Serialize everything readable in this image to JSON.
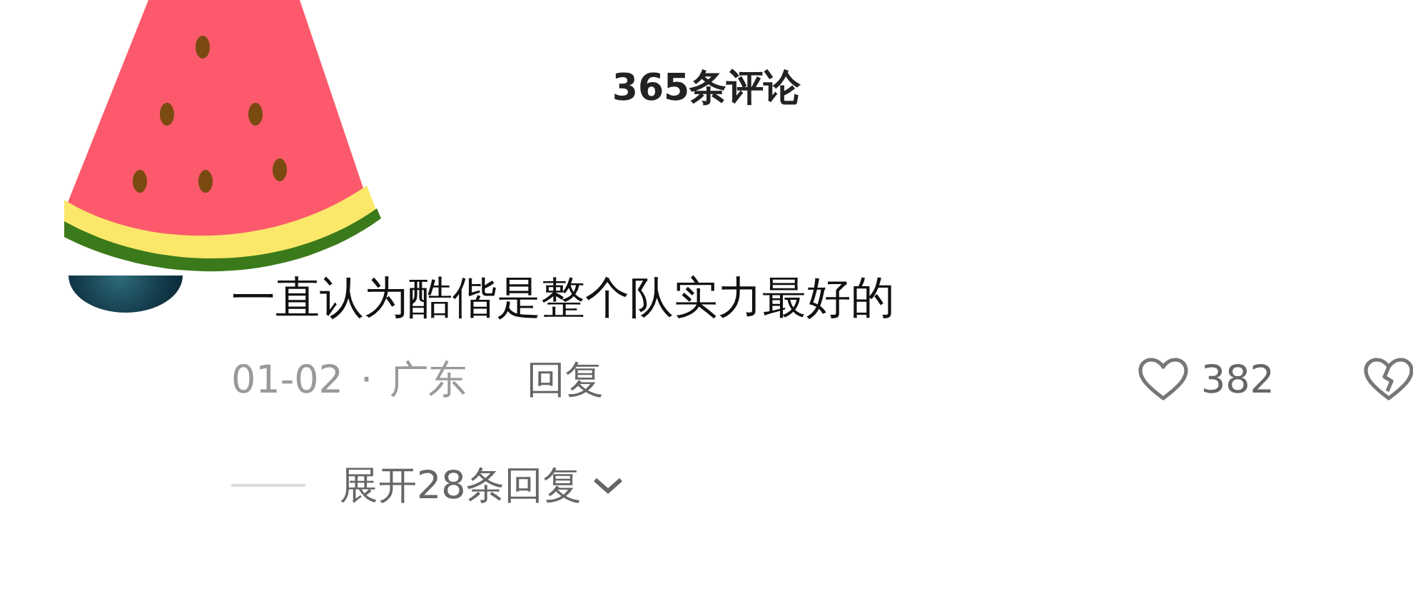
{
  "header": {
    "title": "365条评论"
  },
  "comment": {
    "text": "一直认为酷偕是整个队实力最好的",
    "date": "01-02",
    "separator": "·",
    "location": "广东",
    "reply_label": "回复",
    "likes": "382"
  },
  "expand": {
    "label": "展开28条回复"
  }
}
